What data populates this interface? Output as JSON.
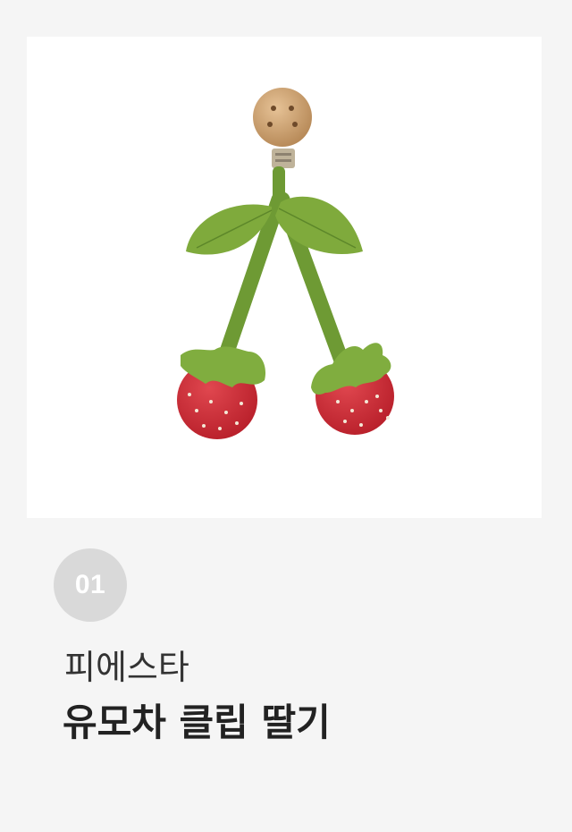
{
  "item": {
    "number": "01",
    "brand": "피에스타",
    "title": "유모차 클립 딸기"
  },
  "image": {
    "subject": "strawberry-stroller-clip"
  }
}
